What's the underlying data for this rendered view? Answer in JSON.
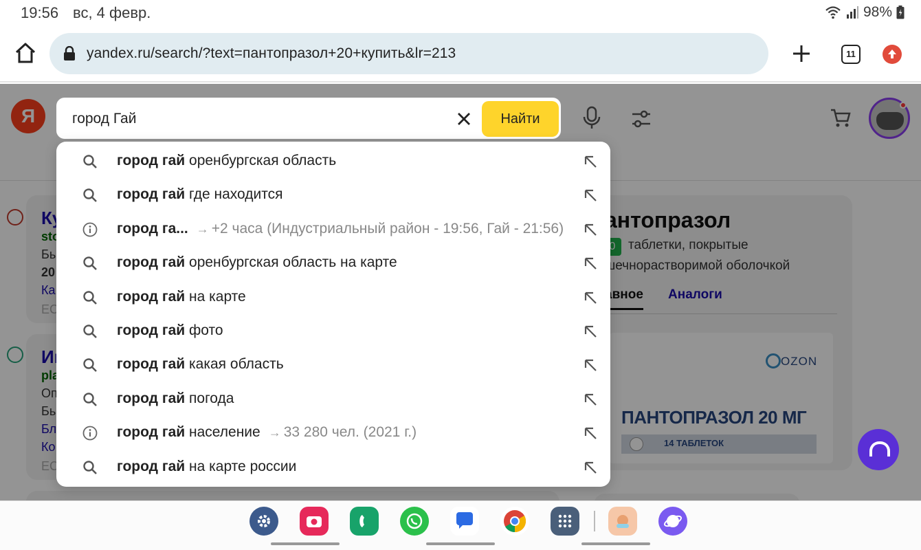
{
  "status_bar": {
    "time": "19:56",
    "date": "вс, 4 февр.",
    "battery": "98%"
  },
  "browser": {
    "url": "yandex.ru/search/?text=пантопразол+20+купить&lr=213",
    "tab_count": "11"
  },
  "search": {
    "logo": "Я",
    "query": "город Гай",
    "find_label": "Найти"
  },
  "suggestions": [
    {
      "bold": "город гай",
      "rest": " оренбургская область",
      "icon": "search-icon",
      "fact": ""
    },
    {
      "bold": "город гай",
      "rest": " где находится",
      "icon": "search-icon",
      "fact": ""
    },
    {
      "bold": "город га...",
      "rest": "",
      "icon": "info-icon",
      "fact": "+2 часа (Индустриальный район - 19:56, Гай - 21:56)"
    },
    {
      "bold": "город гай",
      "rest": " оренбургская область на карте",
      "icon": "search-icon",
      "fact": ""
    },
    {
      "bold": "город гай",
      "rest": " на карте",
      "icon": "search-icon",
      "fact": ""
    },
    {
      "bold": "город гай",
      "rest": " фото",
      "icon": "search-icon",
      "fact": ""
    },
    {
      "bold": "город гай",
      "rest": " какая область",
      "icon": "search-icon",
      "fact": ""
    },
    {
      "bold": "город гай",
      "rest": " погода",
      "icon": "search-icon",
      "fact": ""
    },
    {
      "bold": "город гай",
      "rest": " население",
      "icon": "info-icon",
      "fact": "33 280 чел. (2021 г.)"
    },
    {
      "bold": "город гай",
      "rest": " на карте россии",
      "icon": "search-icon",
      "fact": ""
    }
  ],
  "results": [
    {
      "title": "Ку",
      "site": "sto",
      "line1": "Бь",
      "line2": "20",
      "link": "Ка",
      "grey": "ЕС"
    },
    {
      "title": "Иг",
      "site": "pla",
      "line1": "Оп",
      "line2": "Бь",
      "link": "Бл",
      "link2": "Ко",
      "grey": "ЕС"
    }
  ],
  "side_panel": {
    "title": "антопразол",
    "badge": "0",
    "subtitle_1": "таблетки, покрытые",
    "subtitle_2": "шечнорастворимой оболочкой",
    "tab_main": "авное",
    "tab_analogs": "Аналоги",
    "pack_brand": "OZON",
    "pack_name": "ПАНТОПРАЗОЛ 20 МГ",
    "pack_count": "14 ТАБЛЕТОК"
  },
  "dock_apps": [
    "settings-app",
    "camera-app",
    "phone-app",
    "whatsapp-app",
    "messages-app",
    "chrome-app",
    "apps-grid",
    "game-app",
    "samsung-internet-app"
  ],
  "colors": {
    "yandex_red": "#fc3f1d",
    "find_button": "#fed42b",
    "link": "#1a0dab",
    "alice": "#5a2fd6"
  }
}
